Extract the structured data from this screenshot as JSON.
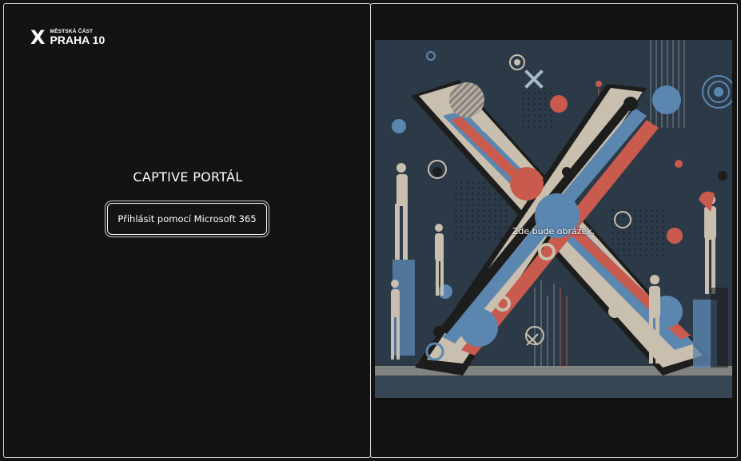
{
  "logo": {
    "mark": "X",
    "line1": "MĚSTSKÁ ČÁST",
    "line2": "PRAHA 10"
  },
  "title": "CAPTIVE PORTÁL",
  "login_button": "Přihlásit pomocí Microsoft 365",
  "image": {
    "caption": "Zde bude obrázek.",
    "colors": {
      "background": "#2c3a48",
      "beige": "#c9bfae",
      "red": "#c85a4e",
      "blue": "#5b86b0",
      "dark": "#1d1d1d"
    }
  }
}
